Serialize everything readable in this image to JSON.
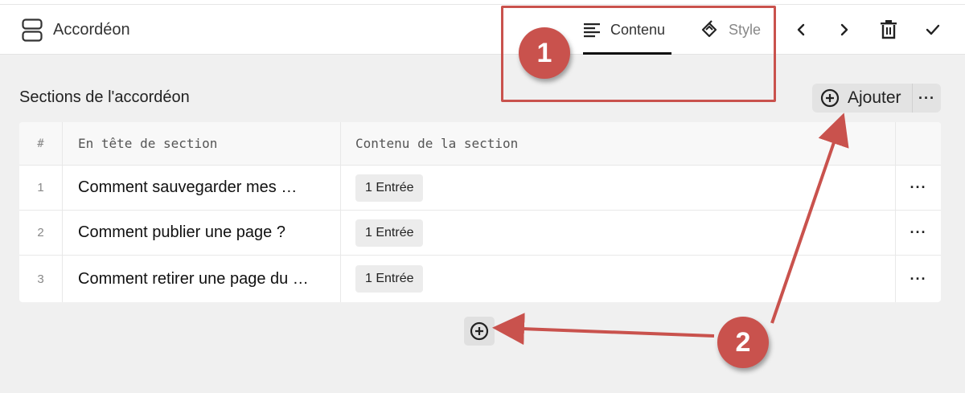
{
  "header": {
    "block_icon": "accordion-block-icon",
    "block_title": "Accordéon",
    "tabs": [
      {
        "label": "Contenu",
        "icon": "align-left-icon",
        "active": true
      },
      {
        "label": "Style",
        "icon": "brush-icon",
        "active": false
      }
    ],
    "actions": [
      {
        "icon": "chevron-left-icon"
      },
      {
        "icon": "chevron-right-icon"
      },
      {
        "icon": "trash-icon"
      },
      {
        "icon": "check-icon"
      }
    ]
  },
  "section": {
    "title": "Sections de l'accordéon",
    "add_label": "Ajouter",
    "more_label": "···"
  },
  "table": {
    "columns": [
      "#",
      "En tête de section",
      "Contenu de la section"
    ],
    "rows": [
      {
        "num": "1",
        "heading": "Comment sauvegarder mes …",
        "content": "1 Entrée",
        "action": "···"
      },
      {
        "num": "2",
        "heading": "Comment publier une page ?",
        "content": "1 Entrée",
        "action": "···"
      },
      {
        "num": "3",
        "heading": "Comment retirer une page du …",
        "content": "1 Entrée",
        "action": "···"
      }
    ]
  },
  "annotations": {
    "marker_1": "1",
    "marker_2": "2",
    "color": "#c9524d"
  }
}
